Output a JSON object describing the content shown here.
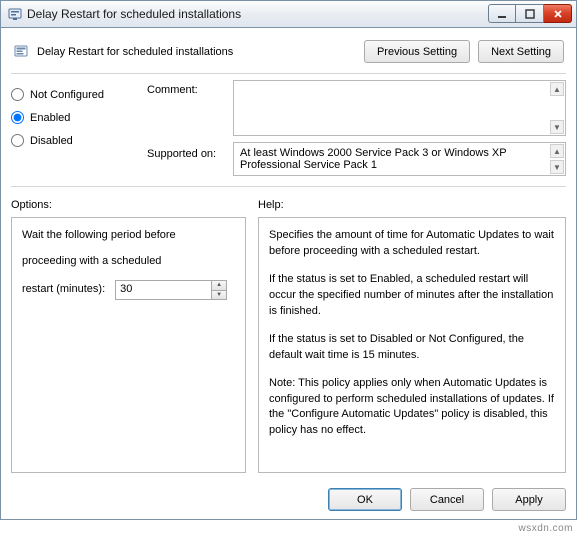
{
  "window_title": "Delay Restart for scheduled installations",
  "header": {
    "page_title": "Delay Restart for scheduled installations",
    "prev_btn": "Previous Setting",
    "next_btn": "Next Setting"
  },
  "state": {
    "not_configured": "Not Configured",
    "enabled": "Enabled",
    "disabled": "Disabled",
    "selected": "enabled"
  },
  "labels": {
    "comment": "Comment:",
    "supported_on": "Supported on:",
    "options": "Options:",
    "help": "Help:"
  },
  "comment_text": "",
  "supported_text": "At least Windows 2000 Service Pack 3 or Windows XP Professional Service Pack 1",
  "options_panel": {
    "line1": "Wait the following period before",
    "line2": "proceeding with a scheduled",
    "line3_label": "restart (minutes):",
    "minutes_value": "30"
  },
  "help_panel": {
    "p1": "Specifies the amount of time for Automatic Updates to wait before proceeding with a scheduled restart.",
    "p2": "If the status is set to Enabled, a scheduled restart will occur the specified number of minutes after the installation is finished.",
    "p3": "If the status is set to Disabled or Not Configured, the default wait time is 15 minutes.",
    "p4": "Note: This policy applies only when Automatic Updates is configured to perform scheduled installations of updates. If the \"Configure Automatic Updates\" policy is disabled, this policy has no effect."
  },
  "footer": {
    "ok": "OK",
    "cancel": "Cancel",
    "apply": "Apply"
  },
  "watermark": "wsxdn.com"
}
